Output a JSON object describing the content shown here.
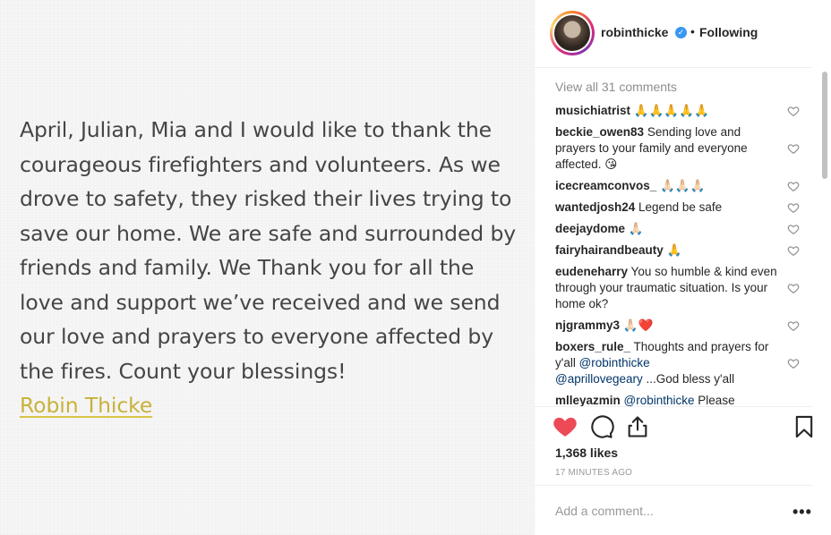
{
  "post": {
    "text": "April, Julian, Mia and I would like to thank the courageous firefighters and volunteers. As we drove to safety, they risked their lives trying to save our home. We are safe and surrounded by friends and family. We Thank you for all the love and support we’ve received and we send our love and prayers to everyone affected by the fires. Count your blessings!",
    "signature": "Robin Thicke"
  },
  "header": {
    "username": "robinthicke",
    "separator": "•",
    "follow_status": "Following"
  },
  "comments": {
    "view_all": "View all 31 comments",
    "items": [
      {
        "user": "musichiatrist",
        "text": " 🙏🙏🙏🙏🙏"
      },
      {
        "user": "beckie_owen83",
        "text": " Sending love and prayers to your family and everyone affected. 😘"
      },
      {
        "user": "icecreamconvos_",
        "text": " 🙏🏻🙏🏻🙏🏻"
      },
      {
        "user": "wantedjosh24",
        "text": " Legend be safe"
      },
      {
        "user": "deejaydome",
        "text": " 🙏🏻"
      },
      {
        "user": "fairyhairandbeauty",
        "text": " 🙏"
      },
      {
        "user": "eudeneharry",
        "text": " You so humble & kind even through your traumatic situation. Is your home ok?"
      },
      {
        "user": "njgrammy3",
        "text": " 🙏🏻❤️"
      },
      {
        "user": "boxers_rule_",
        "text": " Thoughts and prayers for y'all ",
        "mention1": "@robinthicke",
        "mention2": "@aprillovegeary",
        "tail": " ...God bless y'all"
      },
      {
        "user": "mlleyazmin",
        "text": " ",
        "mention1": "@robinthicke",
        "tail": " Please"
      }
    ]
  },
  "actions": {
    "likes": "1,368 likes",
    "timestamp": "17 MINUTES AGO"
  },
  "composer": {
    "placeholder": "Add a comment...",
    "more": "•••"
  },
  "colors": {
    "like_red": "#ed4956",
    "link_blue": "#003569",
    "signature_gold": "#c9b13b",
    "verified_blue": "#3897f0"
  }
}
